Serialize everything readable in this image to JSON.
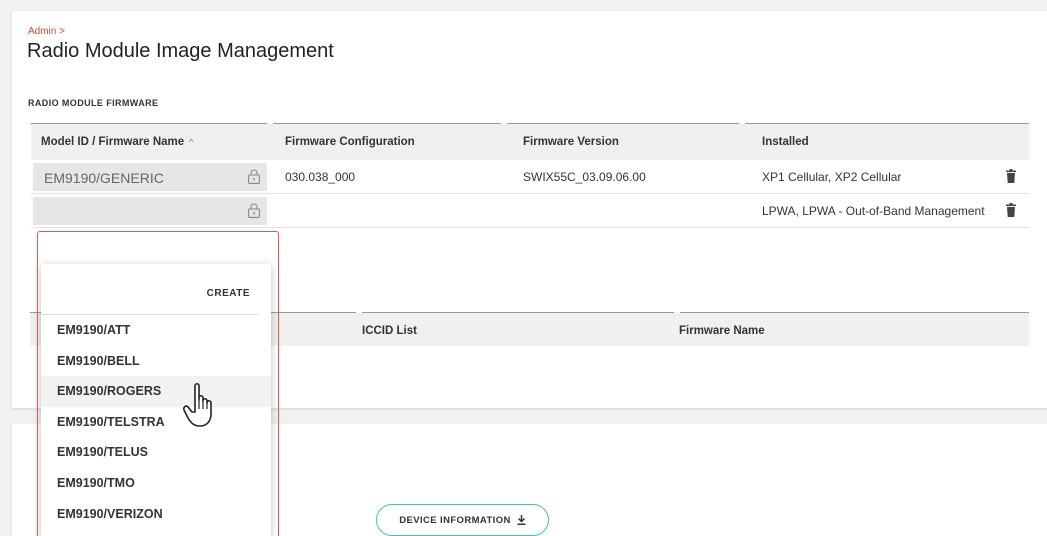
{
  "header": {
    "breadcrumb": "Admin >",
    "title": "Radio Module Image Management",
    "section_label": "RADIO MODULE FIRMWARE"
  },
  "firmware_table": {
    "columns": [
      "Model ID / Firmware Name",
      "Firmware Configuration",
      "Firmware Version",
      "Installed"
    ],
    "rows": [
      {
        "model": "EM9190/GENERIC",
        "config": "030.038_000",
        "version": "SWIX55C_03.09.06.00",
        "installed": "XP1 Cellular, XP2 Cellular"
      },
      {
        "model": "",
        "config": "",
        "version": "",
        "installed": "LPWA, LPWA - Out-of-Band Management"
      }
    ]
  },
  "second_table": {
    "columns": [
      "ICCID List",
      "Firmware Name"
    ]
  },
  "dropdown": {
    "create_label": "CREATE",
    "options": [
      "EM9190/ATT",
      "EM9190/BELL",
      "EM9190/ROGERS",
      "EM9190/TELSTRA",
      "EM9190/TELUS",
      "EM9190/TMO",
      "EM9190/VERIZON"
    ],
    "hovered": "EM9190/ROGERS"
  },
  "footer": {
    "device_info_label": "DEVICE INFORMATION"
  },
  "colors": {
    "accent": "#e0432f",
    "highlight": "#e8554a",
    "button_border": "#3bc1c9"
  }
}
